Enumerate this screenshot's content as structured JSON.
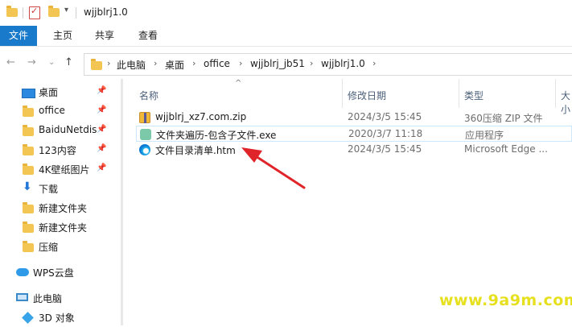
{
  "title": "wjjblrj1.0",
  "ribbon": {
    "tabs": [
      {
        "label": "文件",
        "active": true
      },
      {
        "label": "主页",
        "active": false
      },
      {
        "label": "共享",
        "active": false
      },
      {
        "label": "查看",
        "active": false
      }
    ]
  },
  "address": {
    "crumbs": [
      "此电脑",
      "桌面",
      "office",
      "wjjblrj_jb51",
      "wjjblrj1.0"
    ]
  },
  "sidebar": {
    "items": [
      {
        "label": "桌面",
        "icon": "desktop-icon",
        "pinned": true
      },
      {
        "label": "office",
        "icon": "folder-icon",
        "pinned": true
      },
      {
        "label": "BaiduNetdis",
        "icon": "folder-icon",
        "pinned": true
      },
      {
        "label": "123内容",
        "icon": "folder-icon",
        "pinned": true
      },
      {
        "label": "4K壁纸图片",
        "icon": "folder-icon",
        "pinned": true
      },
      {
        "label": "下载",
        "icon": "download-icon",
        "pinned": false
      },
      {
        "label": "新建文件夹",
        "icon": "folder-icon",
        "pinned": false
      },
      {
        "label": "新建文件夹",
        "icon": "folder-icon",
        "pinned": false
      },
      {
        "label": "压缩",
        "icon": "folder-icon",
        "pinned": false
      },
      {
        "label": "WPS云盘",
        "icon": "cloud-icon",
        "pinned": false
      },
      {
        "label": "此电脑",
        "icon": "computer-icon",
        "pinned": false
      },
      {
        "label": "3D 对象",
        "icon": "cube-icon",
        "pinned": false
      }
    ]
  },
  "columns": {
    "name": "名称",
    "date": "修改日期",
    "type": "类型",
    "size": "大小"
  },
  "files": [
    {
      "name": "wjjblrj_xz7.com.zip",
      "date": "2024/3/5 15:45",
      "type": "360压缩 ZIP 文件",
      "icon": "zip-icon"
    },
    {
      "name": "文件夹遍历-包含子文件.exe",
      "date": "2020/3/7 11:18",
      "type": "应用程序",
      "icon": "exe-icon"
    },
    {
      "name": "文件目录清单.htm",
      "date": "2024/3/5 15:45",
      "type": "Microsoft Edge ...",
      "icon": "edge-icon"
    }
  ],
  "watermark": "www.9a9m.com",
  "colors": {
    "accent": "#1979ca",
    "arrow": "#e0252a",
    "watermark": "#e6e01f"
  }
}
